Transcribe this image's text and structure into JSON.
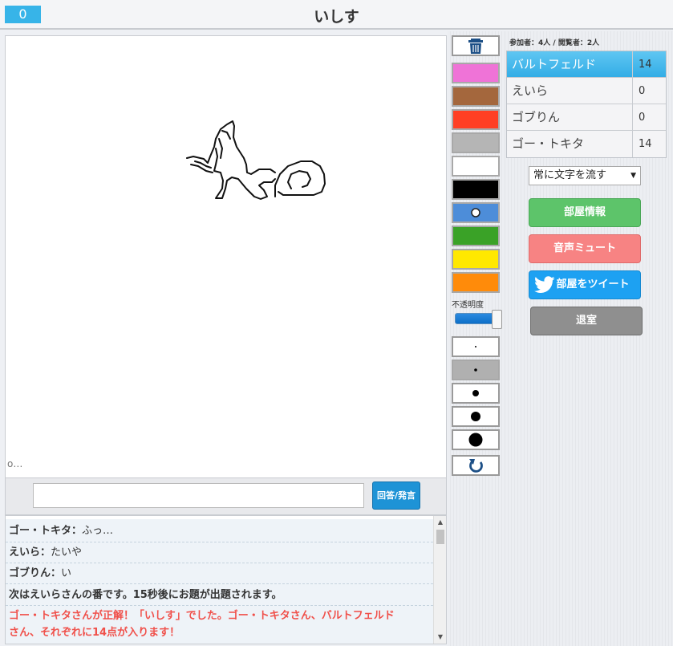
{
  "header": {
    "score": "0",
    "title": "いしす"
  },
  "canvas": {
    "status_text": "o…"
  },
  "answer": {
    "placeholder": "",
    "button_label": "回答/発言"
  },
  "chat": [
    {
      "name": "ゴー・トキタ",
      "sep": "：",
      "text": "ふっ…"
    },
    {
      "name": "えいら",
      "sep": "：",
      "text": "たいや"
    },
    {
      "name": "ゴブりん",
      "sep": "：",
      "text": "い"
    }
  ],
  "system_message": "次はえいらさんの番です。15秒後にお題が出題されます。",
  "correct_message_line1": "ゴー・トキタさんが正解！「いしす」でした。ゴー・トキタさん、バルトフェルド",
  "correct_message_line2": "さん、それぞれに14点が入ります！",
  "toolbar": {
    "trash_icon": "trash-icon",
    "colors": [
      "#ef73d7",
      "#a4673d",
      "#ff3f24",
      "#b5b5b5",
      "#ffffff",
      "#000000",
      "#4d8dd9",
      "#3aa227",
      "#ffe800",
      "#ff8b0a"
    ],
    "opacity_label": "不透明度",
    "opacity_value": 1.0,
    "undo_icon": "undo-icon"
  },
  "room": {
    "counts": "参加者：4人 / 閲覧者：2人",
    "players": [
      {
        "name": "バルトフェルド",
        "score": "14"
      },
      {
        "name": "えいら",
        "score": "0"
      },
      {
        "name": "ゴブりん",
        "score": "0"
      },
      {
        "name": "ゴー・トキタ",
        "score": "14"
      }
    ],
    "flow_option": "常に文字を流す",
    "buttons": {
      "info": "部屋情報",
      "mute": "音声ミュート",
      "tweet": "部屋をツイート",
      "leave": "退室"
    },
    "colors": {
      "active_row": "#33ade6",
      "info": "#5dc46a",
      "mute": "#f78383",
      "tweet": "#1da1f2",
      "leave": "#8f8f8f"
    }
  }
}
